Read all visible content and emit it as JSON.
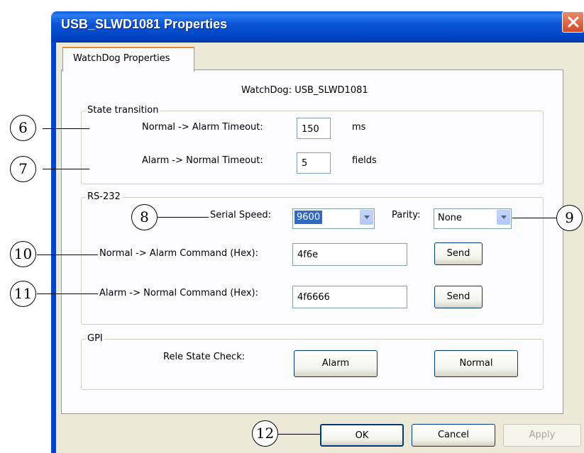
{
  "window": {
    "title": "USB_SLWD1081 Properties",
    "close_icon": "close-icon"
  },
  "tabs": [
    {
      "label": "WatchDog Properties",
      "selected": true
    }
  ],
  "watchdog_label": "WatchDog: USB_SLWD1081",
  "state_transition": {
    "group_title": "State transition",
    "normal_to_alarm_label": "Normal -> Alarm Timeout:",
    "normal_to_alarm_value": "150",
    "normal_to_alarm_unit": "ms",
    "alarm_to_normal_label": "Alarm -> Normal Timeout:",
    "alarm_to_normal_value": "5",
    "alarm_to_normal_unit": "fields"
  },
  "rs232": {
    "group_title": "RS-232",
    "serial_speed_label": "Serial Speed:",
    "serial_speed_value": "9600",
    "parity_label": "Parity:",
    "parity_value": "None",
    "normal_to_alarm_cmd_label": "Normal -> Alarm Command (Hex):",
    "normal_to_alarm_cmd_value": "4f6e",
    "alarm_to_normal_cmd_label": "Alarm -> Normal Command (Hex):",
    "alarm_to_normal_cmd_value": "4f6666",
    "send_label": "Send"
  },
  "gpi": {
    "group_title": "GPI",
    "rele_state_label": "Rele State Check:",
    "alarm_button": "Alarm",
    "normal_button": "Normal"
  },
  "footer": {
    "ok": "OK",
    "cancel": "Cancel",
    "apply": "Apply"
  },
  "callouts": [
    "6",
    "7",
    "8",
    "9",
    "10",
    "11",
    "12"
  ]
}
